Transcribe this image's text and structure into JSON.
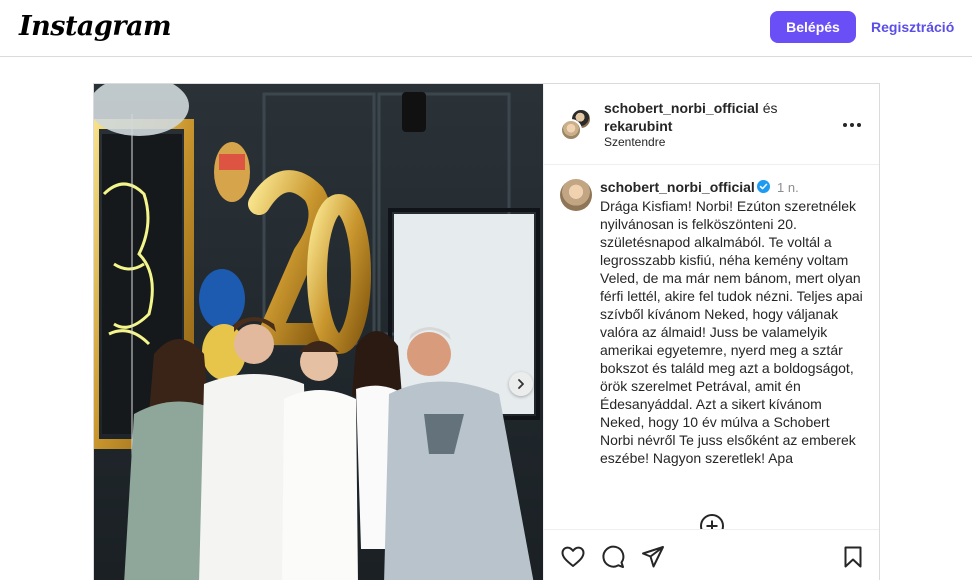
{
  "header": {
    "logo_text": "Instagram",
    "login_label": "Belépés",
    "register_label": "Regisztráció"
  },
  "post": {
    "owner_primary": "schobert_norbi_official",
    "owner_conjunction": "és",
    "owner_secondary": "rekarubint",
    "location": "Szentendre",
    "caption": {
      "username": "schobert_norbi_official",
      "time": "1 n.",
      "text": "Drága Kisfiam! Norbi! Ezúton szeretnélek nyilvánosan is felköszönteni 20. születésnapod alkalmából. Te voltál a legrosszabb kisfiú, néha kemény voltam Veled, de ma már nem bánom, mert olyan férfi lettél, akire fel tudok nézni. Teljes apai szívből kívánom Neked, hogy váljanak valóra az álmaid! Juss be valamelyik amerikai egyetemre, nyerd meg a sztár bokszot és találd meg azt a boldogságot, örök szerelmet Petrával, amit én Édesanyáddal. Azt a sikert kívánom Neked, hogy 10 év múlva a Schobert Norbi névről Te juss elsőként az emberek eszébe! Nagyon szeretlek! Apa"
    }
  },
  "icons": {
    "next": "chevron-right-icon",
    "more": "more-options-icon",
    "verified": "verified-badge-icon",
    "load_more": "plus-circle-icon",
    "like": "heart-icon",
    "comment": "comment-icon",
    "share": "send-icon",
    "save": "bookmark-icon"
  },
  "colors": {
    "accent": "#6a4ff7",
    "link": "#5b4ee8",
    "verified": "#1d9bf0"
  }
}
